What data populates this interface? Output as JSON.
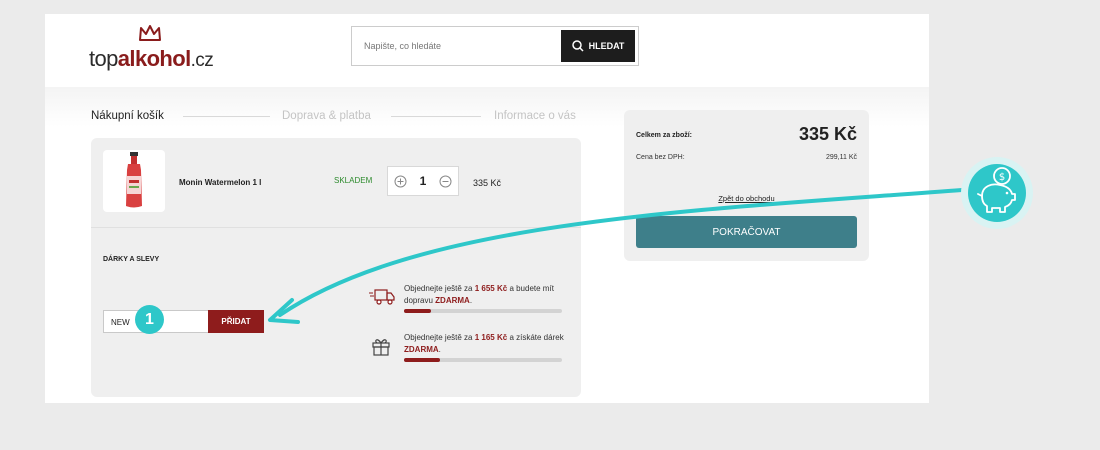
{
  "header": {
    "logo": {
      "part1": "top",
      "part2": "alkohol",
      "part3": ".cz"
    },
    "search": {
      "placeholder": "Napište, co hledáte",
      "button_label": "HLEDAT"
    }
  },
  "steps": [
    {
      "label": "Nákupní košík",
      "state": "active"
    },
    {
      "label": "Doprava & platba",
      "state": "inactive"
    },
    {
      "label": "Informace o vás",
      "state": "inactive"
    }
  ],
  "cart": {
    "item": {
      "name": "Monin Watermelon 1 l",
      "stock": "SKLADEM",
      "quantity": "1",
      "price": "335 Kč"
    },
    "gifts_title": "DÁRKY A SLEVY",
    "coupon": {
      "value": "NEW",
      "button_label": "PŘIDAT"
    },
    "promos": [
      {
        "icon": "delivery-truck-icon",
        "prefix": "Objednejte ještě za",
        "amount": "1 655 Kč",
        "middle": "a budete mít dopravu",
        "highlight": "ZDARMA",
        "suffix": ".",
        "progress": 0.17
      },
      {
        "icon": "gift-icon",
        "prefix": "Objednejte ještě za",
        "amount": "1 165 Kč",
        "middle": "a získáte dárek",
        "highlight": "ZDARMA",
        "suffix": ".",
        "progress": 0.23
      }
    ]
  },
  "summary": {
    "total_label": "Celkem za zboží:",
    "total_value": "335 Kč",
    "net_label": "Cena bez DPH:",
    "net_value": "299,11 Kč",
    "back_link": "Zpět do obchodu",
    "continue_label": "POKRAČOVAT"
  },
  "annotation": {
    "badge": "1",
    "piggy_icon": "piggy-bank-coin-icon"
  },
  "colors": {
    "brand": "#8e1c1c",
    "accent_teal": "#2ec7c9",
    "continue": "#3e7f8a",
    "stock_green": "#2e8b2e"
  }
}
